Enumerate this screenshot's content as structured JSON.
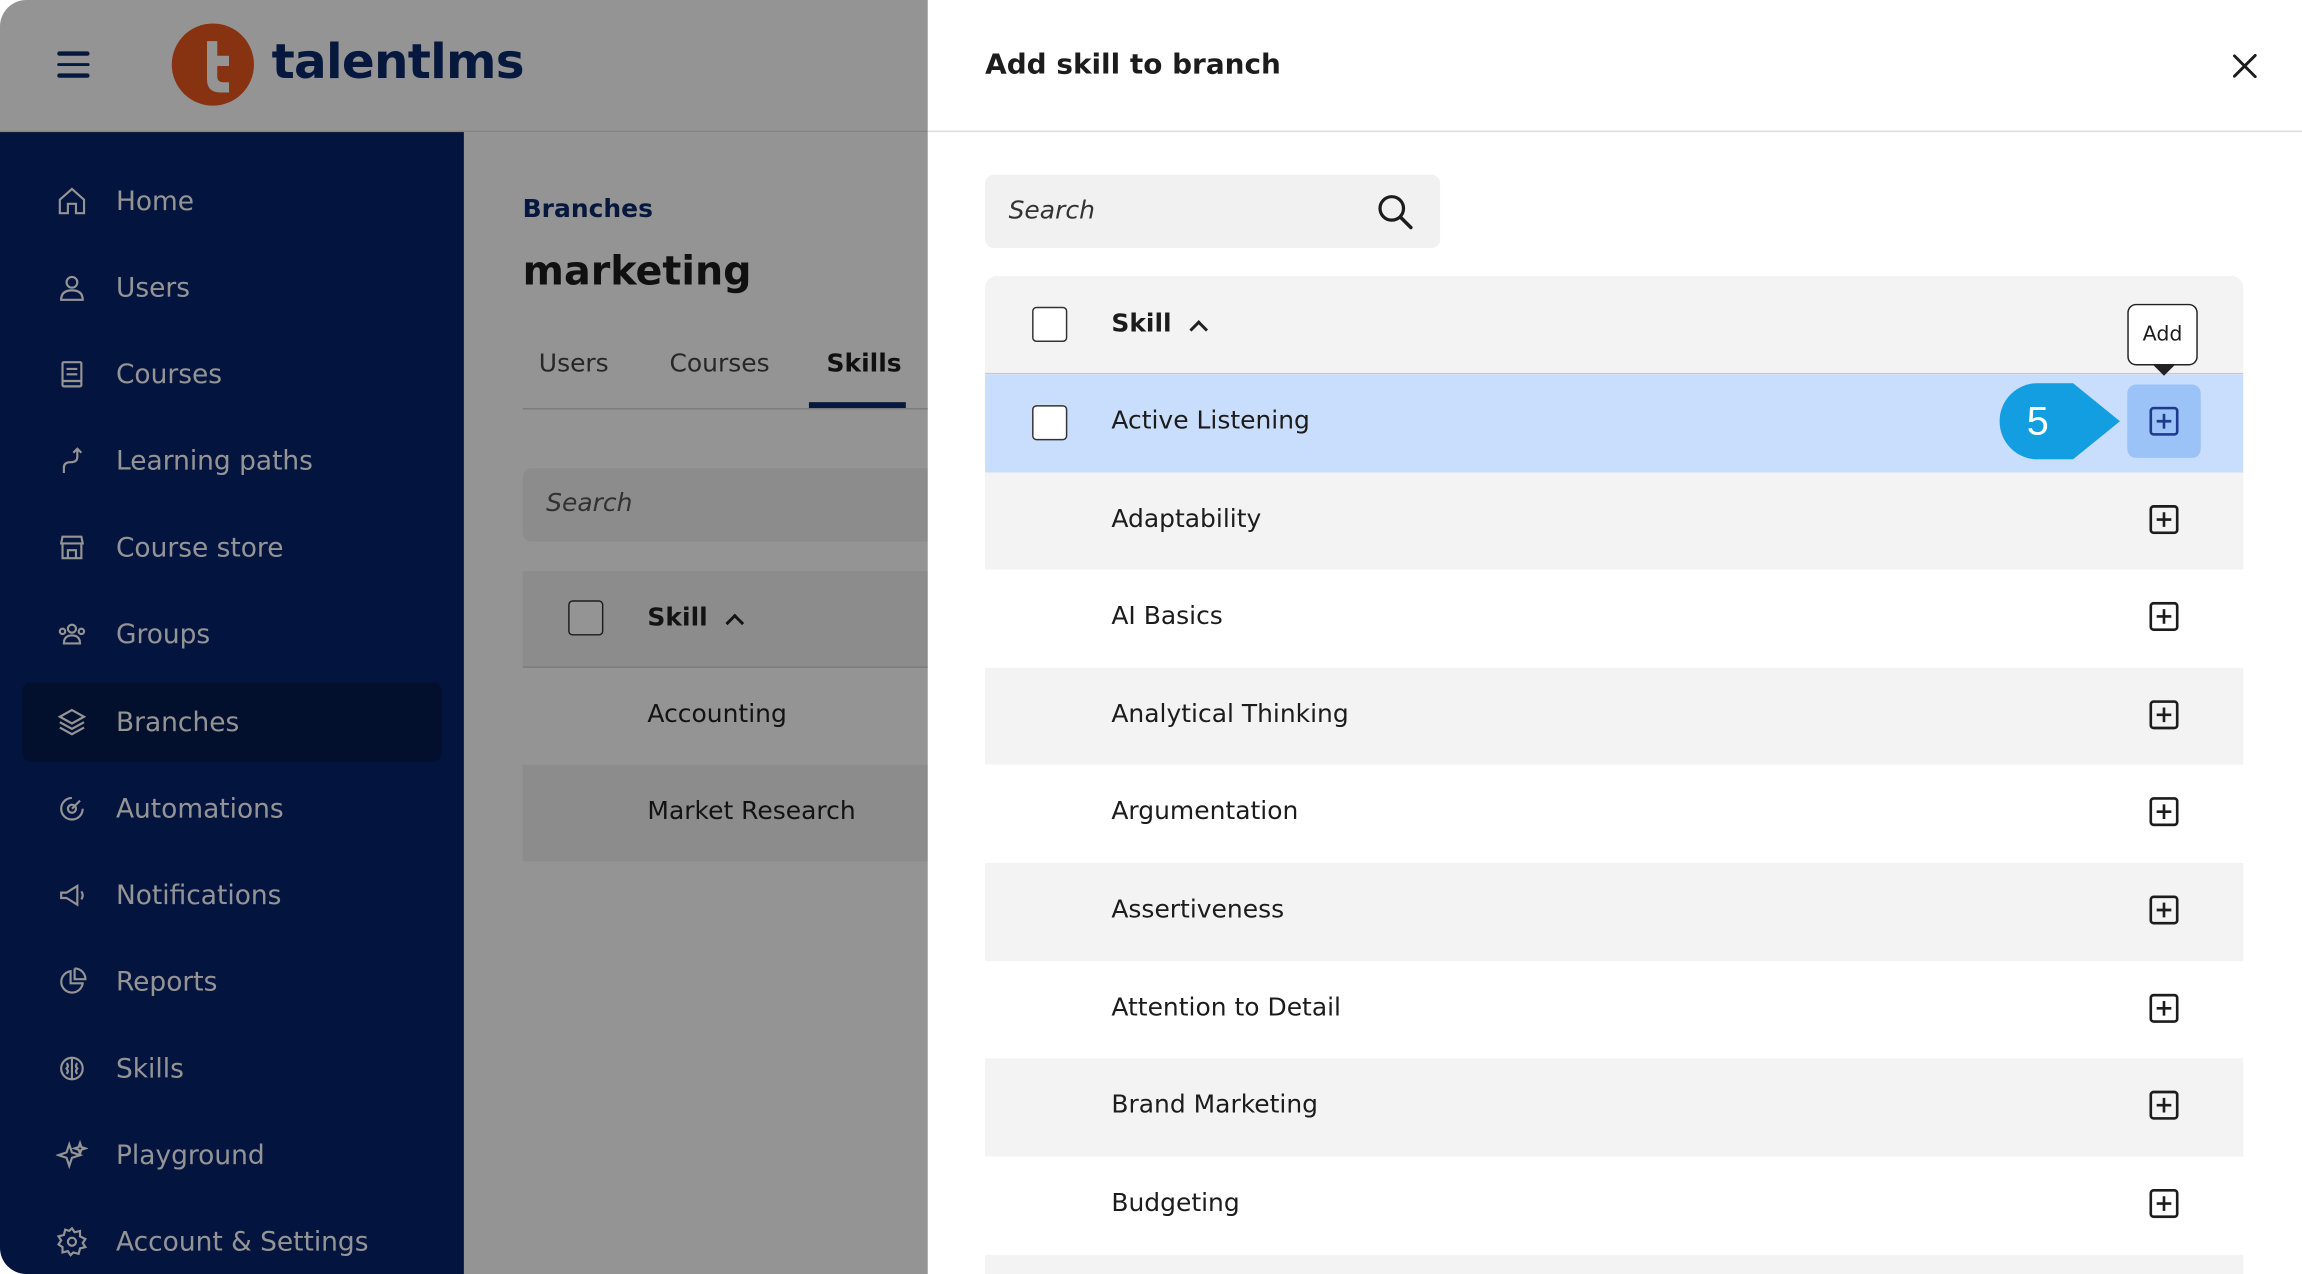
{
  "app": {
    "logo_text": "talentlms",
    "menu_icon": "hamburger-icon"
  },
  "sidebar": {
    "items": [
      {
        "label": "Home",
        "icon": "home-icon"
      },
      {
        "label": "Users",
        "icon": "user-icon"
      },
      {
        "label": "Courses",
        "icon": "book-icon"
      },
      {
        "label": "Learning paths",
        "icon": "path-icon"
      },
      {
        "label": "Course store",
        "icon": "store-icon"
      },
      {
        "label": "Groups",
        "icon": "groups-icon"
      },
      {
        "label": "Branches",
        "icon": "layers-icon",
        "active": true
      },
      {
        "label": "Automations",
        "icon": "automation-icon"
      },
      {
        "label": "Notifications",
        "icon": "megaphone-icon"
      },
      {
        "label": "Reports",
        "icon": "pie-chart-icon"
      },
      {
        "label": "Skills",
        "icon": "brain-icon"
      },
      {
        "label": "Playground",
        "icon": "sparkle-icon"
      },
      {
        "label": "Account & Settings",
        "icon": "gear-icon"
      }
    ]
  },
  "main": {
    "breadcrumb": "Branches",
    "title": "marketing",
    "tabs": [
      {
        "label": "Users"
      },
      {
        "label": "Courses"
      },
      {
        "label": "Skills",
        "active": true
      }
    ],
    "search_placeholder": "Search",
    "table": {
      "header": "Skill",
      "rows": [
        "Accounting",
        "Market Research"
      ]
    }
  },
  "drawer": {
    "title": "Add skill to branch",
    "search_placeholder": "Search",
    "table": {
      "header": "Skill",
      "rows": [
        {
          "label": "Active Listening",
          "selected": true
        },
        {
          "label": "Adaptability"
        },
        {
          "label": "AI Basics"
        },
        {
          "label": "Analytical Thinking"
        },
        {
          "label": "Argumentation"
        },
        {
          "label": "Assertiveness"
        },
        {
          "label": "Attention to Detail"
        },
        {
          "label": "Brand Marketing"
        },
        {
          "label": "Budgeting"
        }
      ]
    },
    "tooltip": "Add",
    "step_marker": "5"
  },
  "colors": {
    "sidebar_bg": "#06246b",
    "sidebar_active": "#041a4f",
    "brand_orange": "#e8571c",
    "selected_row": "#c9ddfc",
    "step_marker": "#129ee0"
  }
}
